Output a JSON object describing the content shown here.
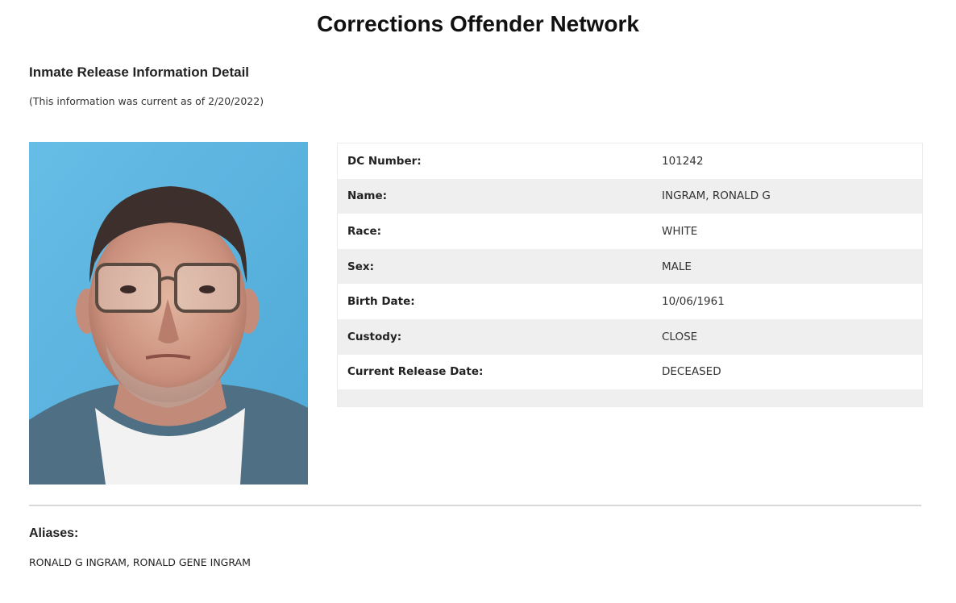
{
  "header": {
    "title": "Corrections Offender Network"
  },
  "section": {
    "heading": "Inmate Release Information Detail",
    "currency_note": "(This information was current as of 2/20/2022)"
  },
  "details": [
    {
      "label": "DC Number:",
      "value": "101242"
    },
    {
      "label": "Name:",
      "value": "INGRAM, RONALD G"
    },
    {
      "label": "Race:",
      "value": "WHITE"
    },
    {
      "label": "Sex:",
      "value": "MALE"
    },
    {
      "label": "Birth Date:",
      "value": "10/06/1961"
    },
    {
      "label": "Custody:",
      "value": "CLOSE"
    },
    {
      "label": "Current Release Date:",
      "value": "DECEASED"
    }
  ],
  "aliases": {
    "heading": "Aliases:",
    "value": "RONALD G INGRAM, RONALD GENE INGRAM"
  },
  "colors": {
    "photo_background": "#5fb6df",
    "row_stripe": "#efefef",
    "divider": "#d8d8d8"
  }
}
